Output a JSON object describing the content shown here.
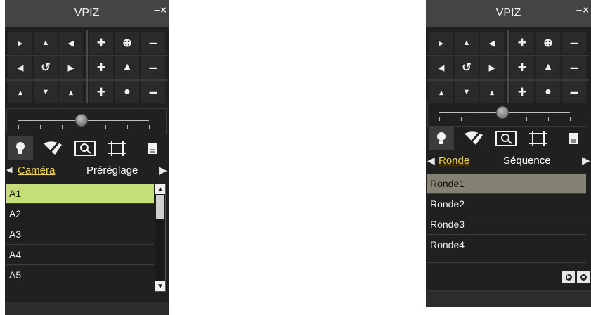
{
  "panels": [
    {
      "title": "VPIZ",
      "window_buttons": "–×",
      "ptz_grid": [
        [
          "►",
          "▲",
          "◄",
          "+",
          "☌",
          "–"
        ],
        [
          "◄",
          "↺",
          "▶",
          "+",
          "▲",
          "–"
        ],
        [
          "▶",
          "▼",
          "◄",
          "+",
          "●",
          "–"
        ]
      ],
      "speed_slider": {
        "value_fraction": 0.48,
        "ticks": 7
      },
      "tools": [
        {
          "icon": "lightbulb-icon",
          "glyph": "💡"
        },
        {
          "icon": "wiper-icon",
          "glyph": "◢"
        },
        {
          "icon": "zoom-box-icon",
          "glyph": "□"
        },
        {
          "icon": "frame-icon",
          "glyph": "⌗"
        },
        {
          "icon": "document-icon",
          "glyph": "■"
        }
      ],
      "mode_tabs": {
        "active": "Caméra",
        "other": "Préréglage"
      },
      "list": [
        "A1",
        "A2",
        "A3",
        "A4",
        "A5"
      ],
      "selected_index": 0
    },
    {
      "title": "VPIZ",
      "window_buttons": "–×",
      "speed_slider": {
        "value_fraction": 0.48,
        "ticks": 7
      },
      "mode_tabs": {
        "active": "Ronde",
        "other": "Séquence"
      },
      "list": [
        "Ronde1",
        "Ronde2",
        "Ronde3",
        "Ronde4"
      ],
      "selected_index": 0,
      "action_buttons": [
        {
          "icon": "play-icon"
        },
        {
          "icon": "record-icon"
        }
      ]
    }
  ],
  "colors": {
    "panel_bg": "#202020",
    "title_bg": "#444444",
    "accent_yellow": "#ffdd00",
    "selected_green": "#c6de78",
    "selected_gray": "#858275"
  }
}
